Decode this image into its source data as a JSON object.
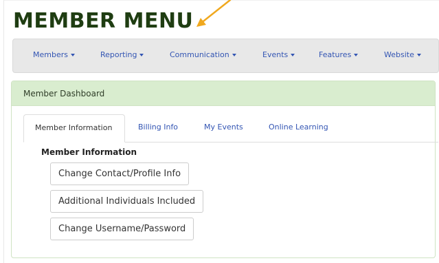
{
  "header": {
    "title": "MEMBER MENU",
    "arrow_color": "#f0a81e",
    "title_color": "#1f3d12"
  },
  "navbar": {
    "items": [
      {
        "label": "Members",
        "icon": "caret-down-icon"
      },
      {
        "label": "Reporting",
        "icon": "caret-down-icon"
      },
      {
        "label": "Communication",
        "icon": "caret-down-icon"
      },
      {
        "label": "Events",
        "icon": "caret-down-icon"
      },
      {
        "label": "Features",
        "icon": "caret-down-icon"
      },
      {
        "label": "Website",
        "icon": "caret-down-icon"
      }
    ],
    "link_color": "#3355b3"
  },
  "panel": {
    "title": "Member Dashboard",
    "heading_color": "#d9edcf",
    "tabs": [
      {
        "label": "Member Information",
        "active": true
      },
      {
        "label": "Billing Info",
        "active": false
      },
      {
        "label": "My Events",
        "active": false
      },
      {
        "label": "Online Learning",
        "active": false
      }
    ],
    "section_title": "Member Information",
    "buttons": [
      {
        "label": "Change Contact/Profile Info"
      },
      {
        "label": "Additional Individuals Included"
      },
      {
        "label": "Change Username/Password"
      }
    ]
  }
}
